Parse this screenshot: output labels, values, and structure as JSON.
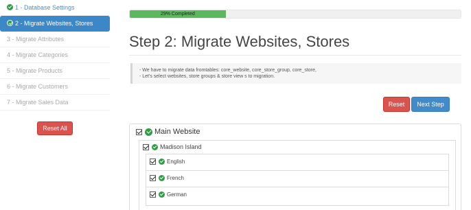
{
  "sidebar": {
    "steps": [
      {
        "label": "1 - Database Settings"
      },
      {
        "label": "2 - Migrate Websites, Stores"
      },
      {
        "label": "3 - Migrate Attributes"
      },
      {
        "label": "4 - Migrate Categories"
      },
      {
        "label": "5 - Migrate Products"
      },
      {
        "label": "6 - Migrate Customers"
      },
      {
        "label": "7 - Migrate Sales Data"
      }
    ],
    "reset_all_label": "Reset All"
  },
  "progress": {
    "percent": 29,
    "label": "29% Completed"
  },
  "page_title": "Step 2: Migrate Websites, Stores",
  "notes": [
    "- We have to migrate data fromtables: core_website, core_store_group, core_store,",
    "- Let's select websites, store groups & store view s to migration."
  ],
  "buttons": {
    "reset_label": "Reset",
    "next_label": "Next Step"
  },
  "tree": {
    "website": {
      "label": "Main Website",
      "checked": true
    },
    "group": {
      "label": "Madison Island",
      "checked": true
    },
    "stores": [
      {
        "label": "English",
        "checked": true
      },
      {
        "label": "French",
        "checked": true
      },
      {
        "label": "German",
        "checked": true
      }
    ]
  },
  "colors": {
    "primary": "#428bca",
    "danger": "#d9534f",
    "success": "#5cb85c",
    "check_green": "#2e9e46"
  }
}
